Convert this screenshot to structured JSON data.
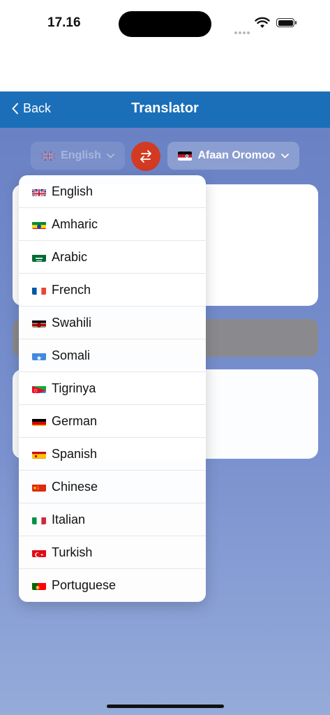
{
  "status_bar": {
    "time": "17.16"
  },
  "header": {
    "back_label": "Back",
    "title": "Translator"
  },
  "source_language": {
    "label": "English",
    "flag": "gb-flag"
  },
  "target_language": {
    "label": "Afaan Oromoo",
    "flag": "oromo-flag"
  },
  "dropdown": {
    "items": [
      {
        "label": "English",
        "flag": "gb"
      },
      {
        "label": "Amharic",
        "flag": "et"
      },
      {
        "label": "Arabic",
        "flag": "sa"
      },
      {
        "label": "French",
        "flag": "fr"
      },
      {
        "label": "Swahili",
        "flag": "ke"
      },
      {
        "label": "Somali",
        "flag": "so"
      },
      {
        "label": "Tigrinya",
        "flag": "er"
      },
      {
        "label": "German",
        "flag": "de"
      },
      {
        "label": "Spanish",
        "flag": "es"
      },
      {
        "label": "Chinese",
        "flag": "cn"
      },
      {
        "label": "Italian",
        "flag": "it"
      },
      {
        "label": "Turkish",
        "flag": "tr"
      },
      {
        "label": "Portuguese",
        "flag": "pt"
      }
    ]
  },
  "colors": {
    "header": "#1a6fb8",
    "swap_button": "#d23a22",
    "background_top": "#6a82c4",
    "background_bottom": "#95abd9"
  }
}
